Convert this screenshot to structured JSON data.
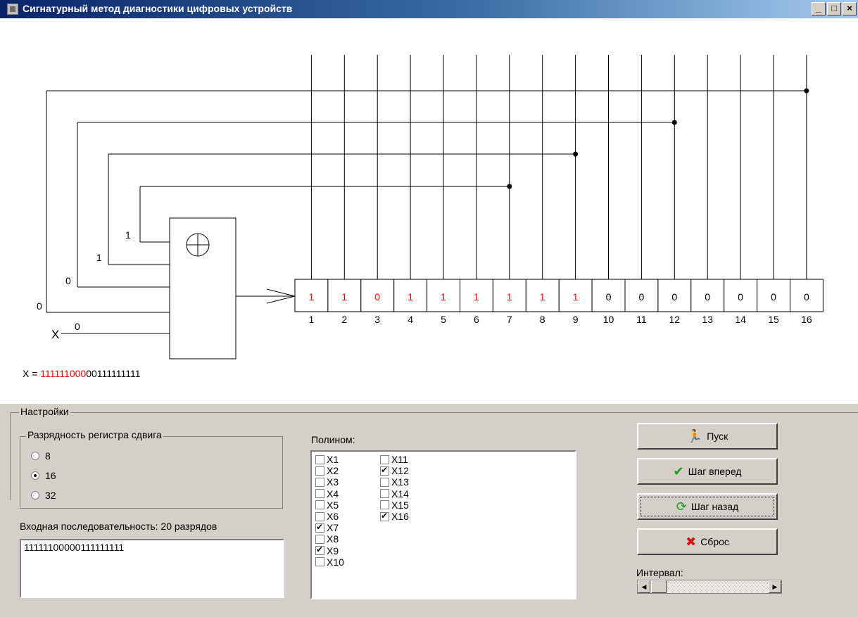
{
  "window": {
    "title": "Сигнатурный метод диагностики цифровых устройств",
    "minimize_label": "_",
    "maximize_label": "□",
    "close_label": "×",
    "titlebar_color": "#0a246a",
    "icon": "chip-icon"
  },
  "diagram": {
    "register_cells": [
      {
        "index": "1",
        "value": "1",
        "highlight": true
      },
      {
        "index": "2",
        "value": "1",
        "highlight": true
      },
      {
        "index": "3",
        "value": "0",
        "highlight": true
      },
      {
        "index": "4",
        "value": "1",
        "highlight": true
      },
      {
        "index": "5",
        "value": "1",
        "highlight": true
      },
      {
        "index": "6",
        "value": "1",
        "highlight": true
      },
      {
        "index": "7",
        "value": "1",
        "highlight": true
      },
      {
        "index": "8",
        "value": "1",
        "highlight": true
      },
      {
        "index": "9",
        "value": "1",
        "highlight": true
      },
      {
        "index": "10",
        "value": "0",
        "highlight": false
      },
      {
        "index": "11",
        "value": "0",
        "highlight": false
      },
      {
        "index": "12",
        "value": "0",
        "highlight": false
      },
      {
        "index": "13",
        "value": "0",
        "highlight": false
      },
      {
        "index": "14",
        "value": "0",
        "highlight": false
      },
      {
        "index": "15",
        "value": "0",
        "highlight": false
      },
      {
        "index": "16",
        "value": "0",
        "highlight": false
      }
    ],
    "taps": [
      {
        "bit": 16,
        "value": "0"
      },
      {
        "bit": 12,
        "value": "0"
      },
      {
        "bit": 9,
        "value": "1"
      },
      {
        "bit": 7,
        "value": "1"
      }
    ],
    "x_input_label": "X",
    "x_input_value": "0",
    "xor_symbol": "⊕",
    "sequence_prefix": "X = ",
    "sequence_highlighted": "111111000",
    "sequence_rest": "00111111111",
    "highlight_color": "#ff0000"
  },
  "settings": {
    "legend": "Настройки",
    "shift_register": {
      "legend": "Разрядность регистра сдвига",
      "options": [
        {
          "label": "8",
          "selected": false
        },
        {
          "label": "16",
          "selected": true
        },
        {
          "label": "32",
          "selected": false
        }
      ]
    },
    "input_label": "Входная последовательность: 20 разрядов",
    "input_value": "11111100000111111111",
    "polynom_label": "Полином:",
    "polynom": [
      {
        "label": "X1",
        "checked": false
      },
      {
        "label": "X2",
        "checked": false
      },
      {
        "label": "X3",
        "checked": false
      },
      {
        "label": "X4",
        "checked": false
      },
      {
        "label": "X5",
        "checked": false
      },
      {
        "label": "X6",
        "checked": false
      },
      {
        "label": "X7",
        "checked": true
      },
      {
        "label": "X8",
        "checked": false
      },
      {
        "label": "X9",
        "checked": true
      },
      {
        "label": "X10",
        "checked": false
      },
      {
        "label": "X11",
        "checked": false
      },
      {
        "label": "X12",
        "checked": true
      },
      {
        "label": "X13",
        "checked": false
      },
      {
        "label": "X14",
        "checked": false
      },
      {
        "label": "X15",
        "checked": false
      },
      {
        "label": "X16",
        "checked": true
      }
    ],
    "buttons": {
      "start": {
        "label": "Пуск",
        "icon": "running-man-icon"
      },
      "step_forward": {
        "label": "Шаг вперед",
        "icon": "checkmark-icon"
      },
      "step_back": {
        "label": "Шаг назад",
        "icon": "refresh-icon"
      },
      "reset": {
        "label": "Сброс",
        "icon": "red-x-icon"
      }
    },
    "interval_label": "Интервал:"
  }
}
